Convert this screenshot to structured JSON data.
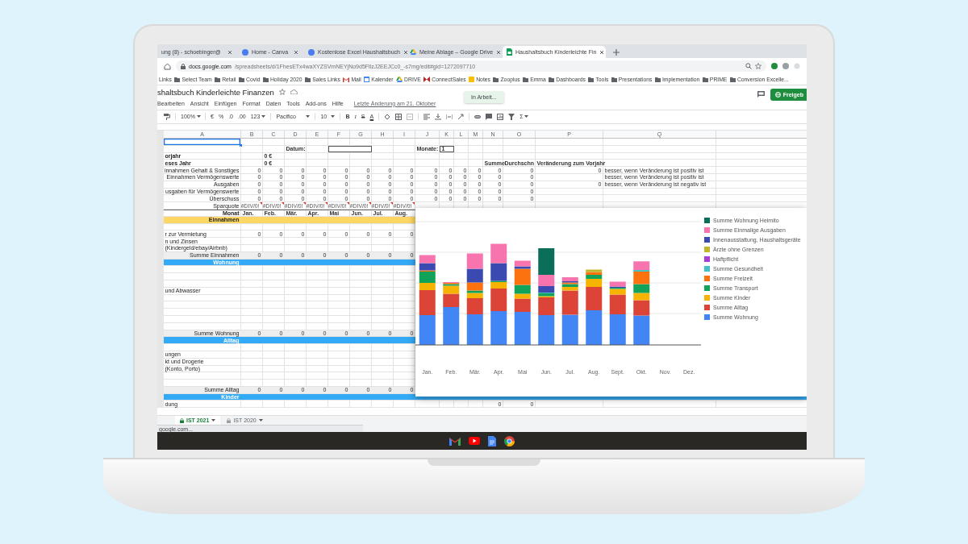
{
  "browser": {
    "tabs": [
      {
        "title": "ung (8) - schoebinger@",
        "kind": "plain",
        "selected": false
      },
      {
        "title": "Home - Canva",
        "kind": "site",
        "selected": false
      },
      {
        "title": "Kostenlose Excel Haushaltsbuch",
        "kind": "site",
        "selected": false
      },
      {
        "title": "Meine Ablage – Google Drive",
        "kind": "drive",
        "selected": false
      },
      {
        "title": "Haushaltsbuch Kinderleichte Fin",
        "kind": "sheets",
        "selected": true
      }
    ],
    "url_host": "docs.google.com",
    "url_path": "/spreadsheets/d/1FhesETx4waXYZSVmNEYjNo9d5FllzJ2EEJCc0_-s7mg/edit#gid=1272097710",
    "bookmarks": [
      {
        "label": "Links",
        "kind": "plain"
      },
      {
        "label": "Select Team",
        "kind": "folder"
      },
      {
        "label": "Retail",
        "kind": "folder"
      },
      {
        "label": "Covid",
        "kind": "folder"
      },
      {
        "label": "Holiday 2020",
        "kind": "folder"
      },
      {
        "label": "Sales Links",
        "kind": "folder"
      },
      {
        "label": "Mail",
        "kind": "mail"
      },
      {
        "label": "Kalender",
        "kind": "calendar"
      },
      {
        "label": "DRIVE",
        "kind": "drive"
      },
      {
        "label": "ConnectSales",
        "kind": "butterfly"
      },
      {
        "label": "Notes",
        "kind": "note"
      },
      {
        "label": "Zooplus",
        "kind": "folder"
      },
      {
        "label": "Emma",
        "kind": "folder"
      },
      {
        "label": "Dashboards",
        "kind": "folder"
      },
      {
        "label": "Tools",
        "kind": "folder"
      },
      {
        "label": "Presentations",
        "kind": "folder"
      },
      {
        "label": "Implementation",
        "kind": "folder"
      },
      {
        "label": "PRIME",
        "kind": "folder"
      },
      {
        "label": "Conversion Excelle...",
        "kind": "folder"
      }
    ]
  },
  "doc": {
    "title": "shaltsbuch Kinderleichte Finanzen",
    "menu": [
      "Bearbeiten",
      "Ansicht",
      "Einfügen",
      "Format",
      "Daten",
      "Tools",
      "Add-ons",
      "Hilfe"
    ],
    "last_edit": "Letzte Änderung am 21. Oktober",
    "toast": "In Arbeit...",
    "share": "Freigeb"
  },
  "toolbar": {
    "zoom": "100%",
    "currency": "€",
    "percent": "%",
    "decimal_decrease": ".0",
    "decimal_increase": ".00",
    "number_format": "123",
    "font": "Pacifico",
    "font_size": "10",
    "bold": "B",
    "italic": "I",
    "strikethrough": "S",
    "text_color": "A",
    "functions": "Σ"
  },
  "sheet": {
    "columns": [
      "A",
      "B",
      "C",
      "D",
      "E",
      "F",
      "G",
      "H",
      "I",
      "J",
      "K",
      "L",
      "M",
      "N",
      "O",
      "P",
      "Q"
    ],
    "rows": [
      {
        "kind": "blank",
        "active": true
      },
      {
        "kind": "params",
        "active": false,
        "cells": {
          "D": "Datum:",
          "J": "Monate:",
          "K": "1"
        }
      },
      {
        "kind": "info",
        "active": false,
        "cells": {
          "A": "orjahr",
          "C": "0 €"
        }
      },
      {
        "kind": "info",
        "active": false,
        "cells": {
          "A": "eses Jahr",
          "C": "0 €",
          "N": "Summe",
          "O": "Durchschn",
          "P": "Veränderung zum Vorjahr"
        }
      },
      {
        "kind": "summary",
        "active": false,
        "cells": {
          "A": "innahmen Gehalt & Sonstiges",
          "B": "0",
          "C": "0",
          "D": "0",
          "E": "0",
          "F": "0",
          "G": "0",
          "H": "0",
          "I": "0",
          "J": "0",
          "K": "0",
          "L": "0",
          "M": "0",
          "N": "0",
          "O": "0",
          "P": "0",
          "Q": "besser, wenn Veränderung ist positiv ist"
        }
      },
      {
        "kind": "summary",
        "active": false,
        "cells": {
          "A": "Einnahmen Vermögenswerte",
          "B": "0",
          "C": "0",
          "D": "0",
          "E": "0",
          "F": "0",
          "G": "0",
          "H": "0",
          "I": "0",
          "J": "0",
          "K": "0",
          "L": "0",
          "M": "0",
          "N": "0",
          "O": "0",
          "Q": "besser, wenn Veränderung ist positiv ist"
        }
      },
      {
        "kind": "summary",
        "active": false,
        "cells": {
          "A": "Ausgaben",
          "B": "0",
          "C": "0",
          "D": "0",
          "E": "0",
          "F": "0",
          "G": "0",
          "H": "0",
          "I": "0",
          "J": "0",
          "K": "0",
          "L": "0",
          "M": "0",
          "N": "0",
          "O": "0",
          "P": "0",
          "Q": "besser, wenn Veränderung ist negativ ist"
        }
      },
      {
        "kind": "summary",
        "active": false,
        "cells": {
          "A": "usgaben für Vermögenswerte",
          "B": "0",
          "C": "0",
          "D": "0",
          "E": "0",
          "F": "0",
          "G": "0",
          "H": "0",
          "I": "0",
          "J": "0",
          "K": "0",
          "L": "0",
          "M": "0",
          "N": "0",
          "O": "0"
        }
      },
      {
        "kind": "summary",
        "active": false,
        "cells": {
          "A": "Überschuss",
          "B": "0",
          "C": "0",
          "D": "0",
          "E": "0",
          "F": "0",
          "G": "0",
          "H": "0",
          "I": "0",
          "J": "0",
          "K": "0",
          "L": "0",
          "M": "0",
          "N": "0",
          "O": "0"
        }
      },
      {
        "kind": "errors",
        "active": false,
        "cells": {
          "A": "Sparquote",
          "B": "#DIV/0!",
          "C": "#DIV/0!",
          "D": "#DIV/0!",
          "E": "#DIV/0!",
          "F": "#DIV/0!",
          "G": "#DIV/0!",
          "H": "#DIV/0!",
          "I": "#DIV/0!"
        }
      },
      {
        "kind": "header",
        "active": false,
        "cells": {
          "A": "Monat",
          "B": "Jan.",
          "C": "Feb.",
          "D": "Mär.",
          "E": "Apr.",
          "F": "Mai",
          "G": "Jun.",
          "H": "Jul.",
          "I": "Aug."
        }
      },
      {
        "kind": "band",
        "active": false,
        "color": "#fdd663",
        "cells": {
          "A": "Einnahmen"
        }
      },
      {
        "kind": "blank",
        "active": false
      },
      {
        "kind": "detail",
        "active": false,
        "cells": {
          "A": "r zur Vermietung",
          "B": "0",
          "C": "0",
          "D": "0",
          "E": "0",
          "F": "0",
          "G": "0",
          "H": "0",
          "I": "0"
        }
      },
      {
        "kind": "detail",
        "active": false,
        "cells": {
          "A": "n und Zinsen"
        }
      },
      {
        "kind": "detail",
        "active": false,
        "cells": {
          "A": "(Kindergeld/ebay/Airbnb)"
        }
      },
      {
        "kind": "sum",
        "active": false,
        "cells": {
          "A": "Summe Einnahmen",
          "B": "0",
          "C": "0",
          "D": "0",
          "E": "0",
          "F": "0",
          "G": "0",
          "H": "0",
          "I": "0"
        }
      },
      {
        "kind": "band",
        "active": false,
        "color": "#33aaf5",
        "cells": {
          "A": "Wohnung"
        }
      },
      {
        "kind": "blank",
        "active": false
      },
      {
        "kind": "blank",
        "active": false
      },
      {
        "kind": "blank",
        "active": false
      },
      {
        "kind": "detail",
        "active": false,
        "cells": {
          "A": "und Abwasser"
        }
      },
      {
        "kind": "blank",
        "active": false
      },
      {
        "kind": "blank",
        "active": false
      },
      {
        "kind": "blank",
        "active": false
      },
      {
        "kind": "blank",
        "active": false
      },
      {
        "kind": "blank",
        "active": false
      },
      {
        "kind": "sum",
        "active": false,
        "cells": {
          "A": "Summe Wohnung",
          "B": "0",
          "C": "0",
          "D": "0",
          "E": "0",
          "F": "0",
          "G": "0",
          "H": "0",
          "I": "0"
        }
      },
      {
        "kind": "band",
        "active": false,
        "color": "#33aaf5",
        "cells": {
          "A": "Alltag"
        }
      },
      {
        "kind": "blank",
        "active": false
      },
      {
        "kind": "detail",
        "active": false,
        "cells": {
          "A": "ungen"
        }
      },
      {
        "kind": "detail",
        "active": false,
        "cells": {
          "A": "kt und Drogerie"
        }
      },
      {
        "kind": "detail",
        "active": false,
        "cells": {
          "A": "(Konto, Porto)"
        }
      },
      {
        "kind": "blank",
        "active": false
      },
      {
        "kind": "blank",
        "active": false
      },
      {
        "kind": "sum",
        "active": false,
        "cells": {
          "A": "Summe Alltag",
          "B": "0",
          "C": "0",
          "D": "0",
          "E": "0",
          "F": "0",
          "G": "0",
          "H": "0",
          "I": "0"
        }
      },
      {
        "kind": "band",
        "active": false,
        "color": "#33aaf5",
        "cells": {
          "A": "Kinder"
        }
      },
      {
        "kind": "detail",
        "active": false,
        "cells": {
          "A": "dung",
          "N": "0",
          "O": "0"
        }
      }
    ]
  },
  "chart": {
    "months": [
      "Jan.",
      "Feb.",
      "Mär.",
      "Apr.",
      "Mai",
      "Jun.",
      "Jul.",
      "Aug.",
      "Sept.",
      "Okt.",
      "Nov.",
      "Dez."
    ],
    "legend": [
      {
        "label": "Summe Wohnung Heimito",
        "color": "#0b6e58"
      },
      {
        "label": "Summe Einmalige Ausgaben",
        "color": "#f774ae"
      },
      {
        "label": "Innenausstattung, Haushaltsgeräte",
        "color": "#3b4ab1"
      },
      {
        "label": "Ärzte ohne Grenzen",
        "color": "#bfb62a"
      },
      {
        "label": "Haftpflicht",
        "color": "#a93ed6"
      },
      {
        "label": "Summe Gesundheit",
        "color": "#46bfc6"
      },
      {
        "label": "Summe Freizeit",
        "color": "#fb720f"
      },
      {
        "label": "Summe Transport",
        "color": "#11a35a"
      },
      {
        "label": "Summe Kinder",
        "color": "#f6b400"
      },
      {
        "label": "Summe Alltag",
        "color": "#db4437"
      },
      {
        "label": "Summe Wohnung",
        "color": "#4285f4"
      }
    ]
  },
  "sheet_tabs": [
    {
      "label": "IST 2021",
      "selected": true
    },
    {
      "label": "IST 2020",
      "selected": false
    }
  ],
  "status_url": "google.com..."
}
